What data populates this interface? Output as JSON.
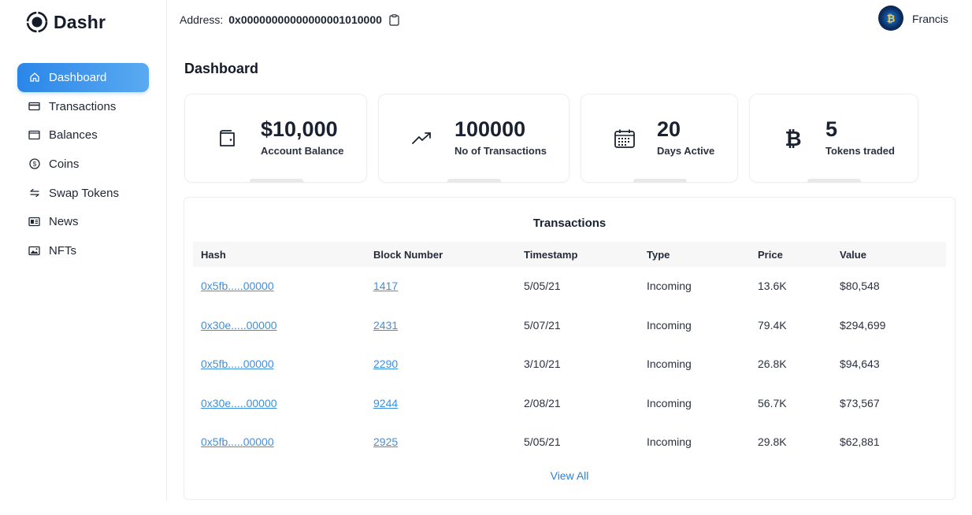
{
  "app": {
    "name": "Dashr"
  },
  "sidebar": {
    "items": [
      {
        "label": "Dashboard",
        "icon": "home-icon",
        "active": true
      },
      {
        "label": "Transactions",
        "icon": "credit-card-icon",
        "active": false
      },
      {
        "label": "Balances",
        "icon": "wallet-icon",
        "active": false
      },
      {
        "label": "Coins",
        "icon": "coin-icon",
        "active": false
      },
      {
        "label": "Swap Tokens",
        "icon": "swap-icon",
        "active": false
      },
      {
        "label": "News",
        "icon": "newspaper-icon",
        "active": false
      },
      {
        "label": "NFTs",
        "icon": "image-icon",
        "active": false
      }
    ]
  },
  "header": {
    "address_label": "Address:",
    "address_value": "0x00000000000000001010000",
    "user_name": "Francis"
  },
  "page": {
    "title": "Dashboard"
  },
  "stats": [
    {
      "value": "$10,000",
      "label": "Account Balance",
      "icon": "wallet-icon"
    },
    {
      "value": "100000",
      "label": "No of Transactions",
      "icon": "trending-up-icon"
    },
    {
      "value": "20",
      "label": "Days Active",
      "icon": "calendar-icon"
    },
    {
      "value": "5",
      "label": "Tokens traded",
      "icon": "bitcoin-icon"
    }
  ],
  "transactions": {
    "title": "Transactions",
    "columns": [
      "Hash",
      "Block Number",
      "Timestamp",
      "Type",
      "Price",
      "Value"
    ],
    "rows": [
      [
        "0x5fb.....00000",
        "1417",
        "5/05/21",
        "Incoming",
        "13.6K",
        "$80,548"
      ],
      [
        "0x30e.....00000",
        "2431",
        "5/07/21",
        "Incoming",
        "79.4K",
        "$294,699"
      ],
      [
        "0x5fb.....00000",
        "2290",
        "3/10/21",
        "Incoming",
        "26.8K",
        "$94,643"
      ],
      [
        "0x30e.....00000",
        "9244",
        "2/08/21",
        "Incoming",
        "56.7K",
        "$73,567"
      ],
      [
        "0x5fb.....00000",
        "2925",
        "5/05/21",
        "Incoming",
        "29.8K",
        "$62,881"
      ]
    ],
    "view_all_label": "View All"
  },
  "colors": {
    "accent": "#2a86e8",
    "link": "#3d8fe0",
    "text": "#1c2433"
  }
}
